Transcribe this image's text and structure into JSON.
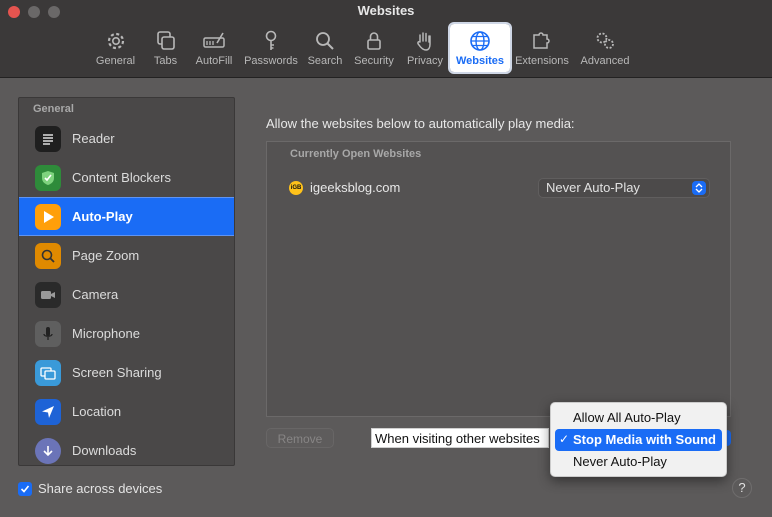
{
  "window": {
    "title": "Websites"
  },
  "toolbar": {
    "tabs": [
      {
        "label": "General",
        "icon": "gear-icon"
      },
      {
        "label": "Tabs",
        "icon": "tabs-icon"
      },
      {
        "label": "AutoFill",
        "icon": "autofill-icon"
      },
      {
        "label": "Passwords",
        "icon": "key-icon"
      },
      {
        "label": "Search",
        "icon": "magnifier-icon"
      },
      {
        "label": "Security",
        "icon": "lock-icon"
      },
      {
        "label": "Privacy",
        "icon": "hand-icon"
      },
      {
        "label": "Websites",
        "icon": "globe-icon",
        "active": true
      },
      {
        "label": "Extensions",
        "icon": "puzzle-icon"
      },
      {
        "label": "Advanced",
        "icon": "gears-icon"
      }
    ]
  },
  "sidebar": {
    "header": "General",
    "items": [
      {
        "label": "Reader",
        "icon": "reader-icon"
      },
      {
        "label": "Content Blockers",
        "icon": "shield-icon"
      },
      {
        "label": "Auto-Play",
        "icon": "play-icon",
        "active": true
      },
      {
        "label": "Page Zoom",
        "icon": "zoom-icon"
      },
      {
        "label": "Camera",
        "icon": "camera-icon"
      },
      {
        "label": "Microphone",
        "icon": "microphone-icon"
      },
      {
        "label": "Screen Sharing",
        "icon": "screen-sharing-icon"
      },
      {
        "label": "Location",
        "icon": "location-icon"
      },
      {
        "label": "Downloads",
        "icon": "download-icon"
      }
    ]
  },
  "main": {
    "description": "Allow the websites below to automatically play media:",
    "list_header": "Currently Open Websites",
    "site": {
      "name": "igeeksblog.com",
      "favicon_text": "iGB",
      "setting": "Never Auto-Play"
    },
    "remove_label": "Remove",
    "other_websites_label": "When visiting other websites"
  },
  "popup_menu": {
    "options": [
      "Allow All Auto-Play",
      "Stop Media with Sound",
      "Never Auto-Play"
    ],
    "selected_index": 1,
    "check_glyph": "✓"
  },
  "footer": {
    "share_label": "Share across devices",
    "share_checked": true,
    "help_label": "?"
  },
  "colors": {
    "accent": "#1a6cf5",
    "favicon": "#ffc21a"
  }
}
